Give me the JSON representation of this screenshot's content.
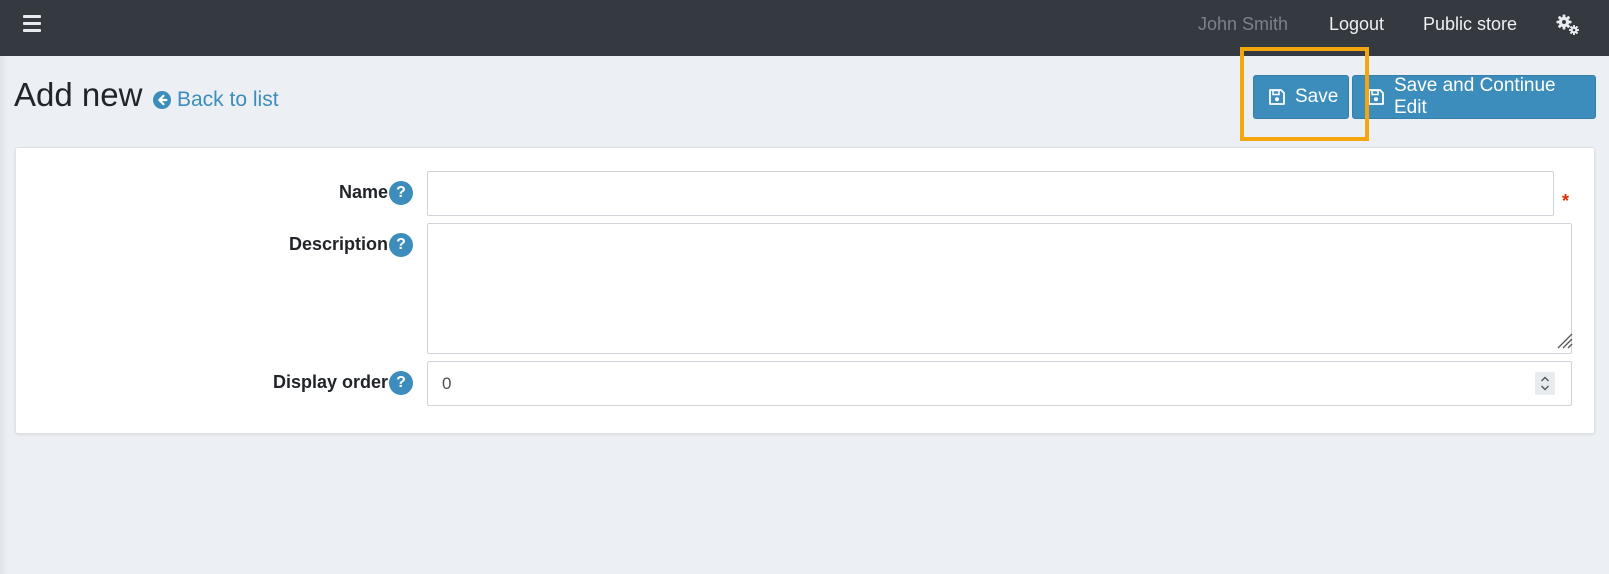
{
  "navbar": {
    "user_name": "John Smith",
    "logout_label": "Logout",
    "public_store_label": "Public store",
    "menu_icon": "hamburger-menu-icon",
    "settings_icon": "gears-icon"
  },
  "header": {
    "title": "Add new",
    "back_label": "Back to list",
    "save_label": "Save",
    "save_continue_label": "Save and Continue Edit"
  },
  "form": {
    "name_label": "Name",
    "name_value": "",
    "required_mark": "*",
    "description_label": "Description",
    "description_value": "",
    "display_order_label": "Display order",
    "display_order_value": "0",
    "help_symbol": "?"
  },
  "colors": {
    "navbar": "#343a40",
    "accent": "#3c8dbc",
    "highlight": "#f4a60f",
    "required": "#dd2c00"
  }
}
